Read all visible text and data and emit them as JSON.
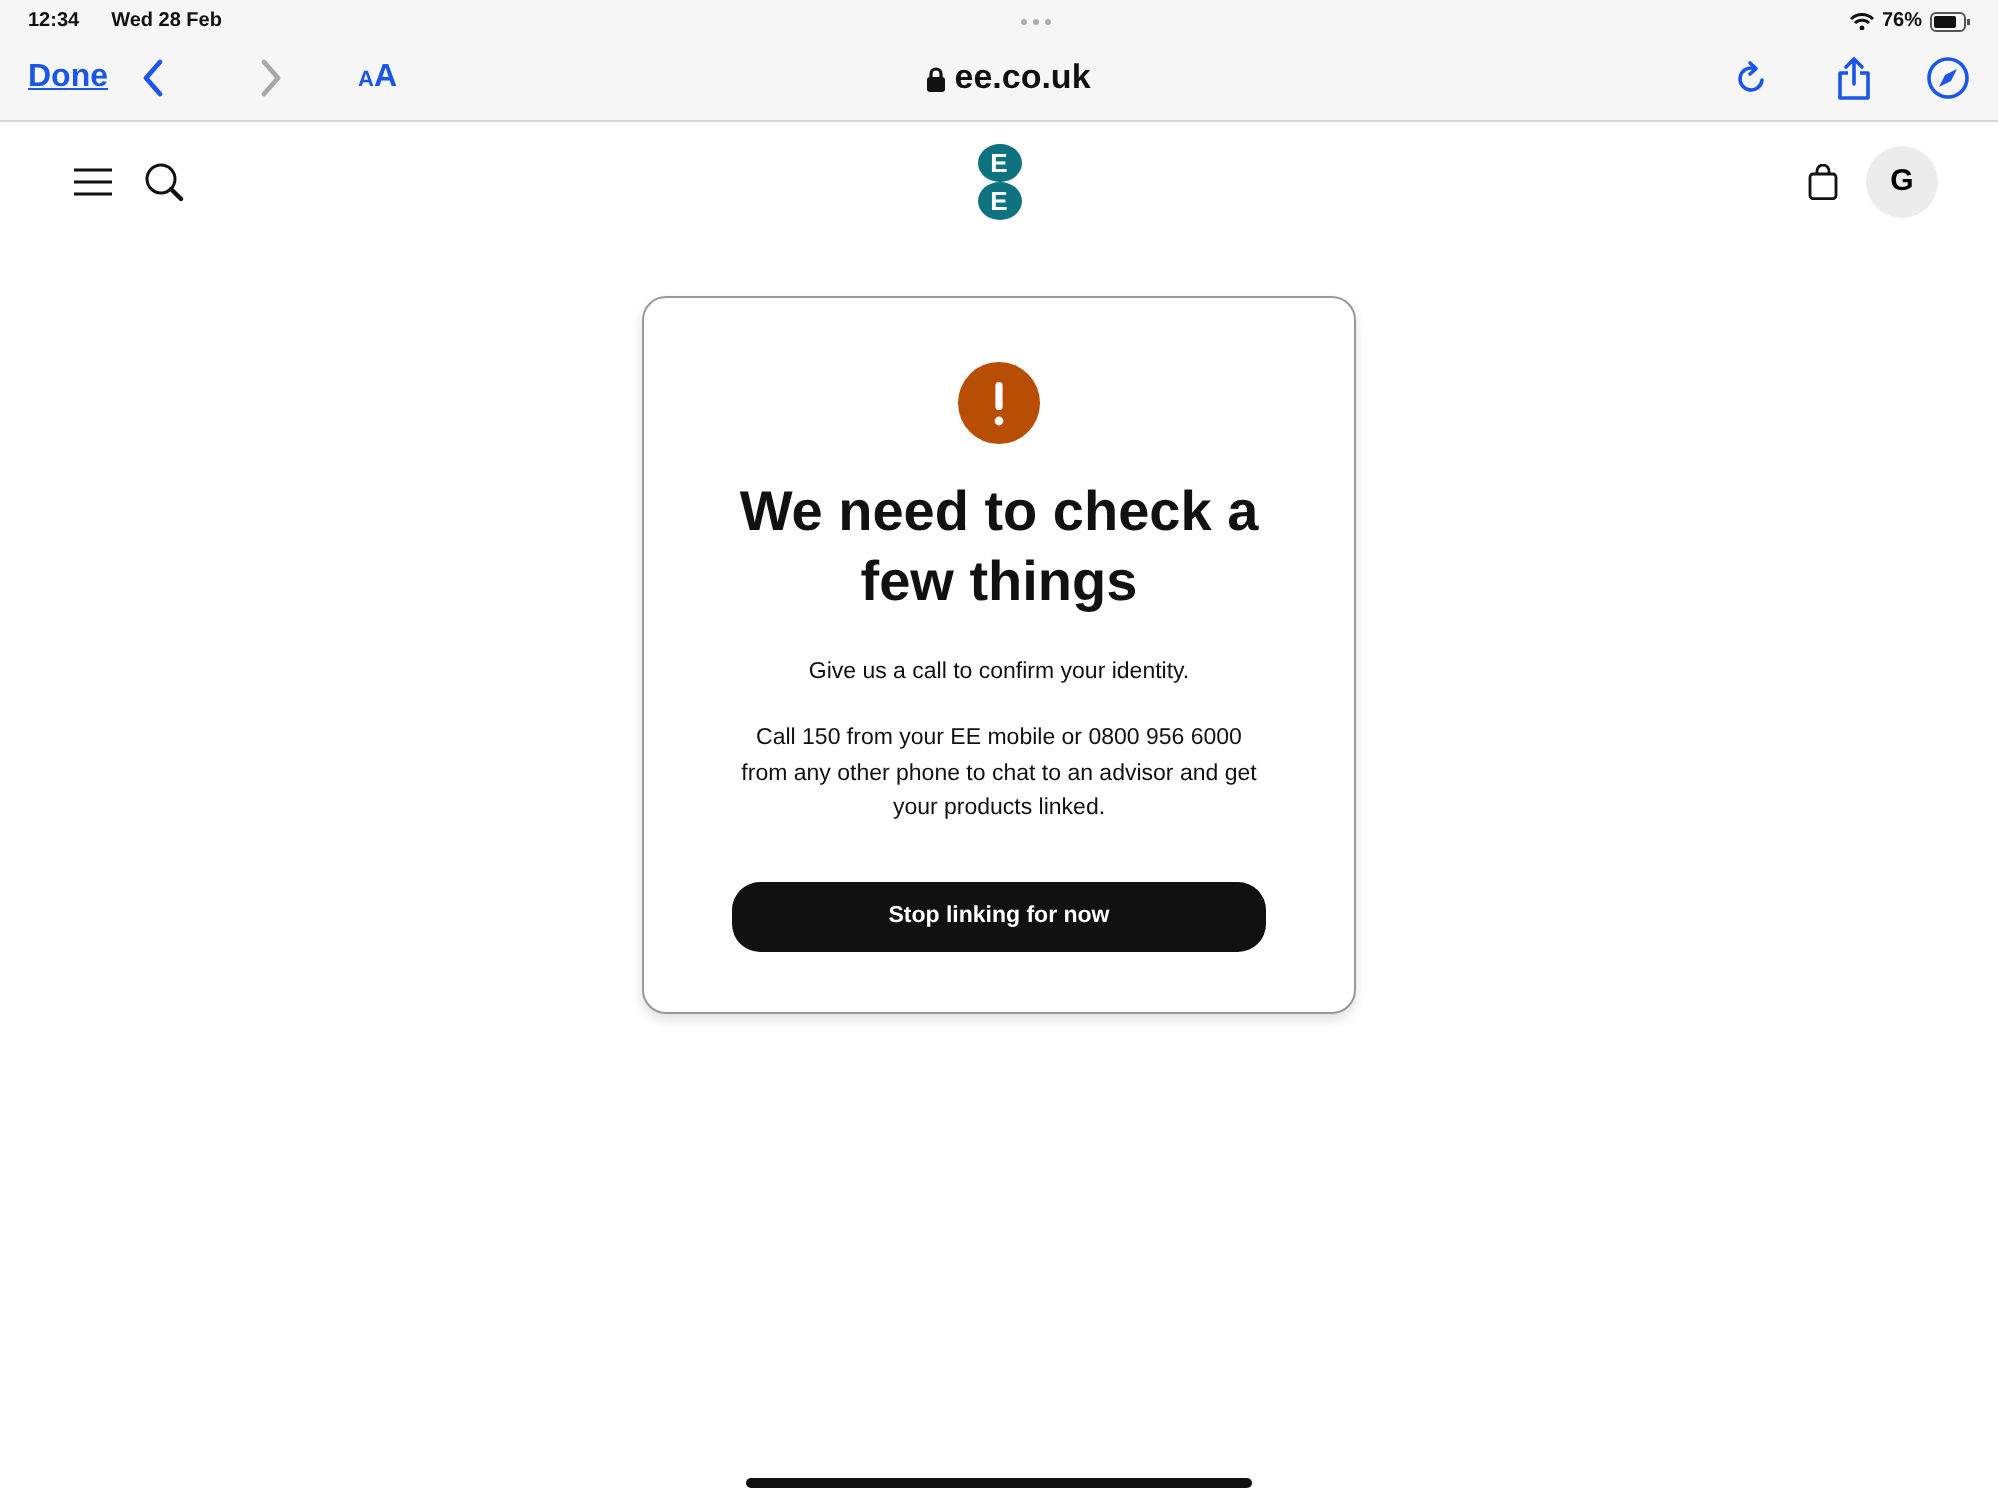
{
  "status_bar": {
    "time": "12:34",
    "date": "Wed 28 Feb",
    "battery": "76%"
  },
  "browser_toolbar": {
    "done": "Done",
    "back": {
      "disabled": false
    },
    "forward": {
      "disabled": true
    },
    "text_size": [
      "A",
      "A"
    ],
    "address": "ee.co.uk"
  },
  "site_header": {
    "logo": [
      "E",
      "E"
    ],
    "account_initial": "G"
  },
  "dialog": {
    "title": "We need to check a few things",
    "paragraphs": [
      "Give us a call to confirm your identity.",
      "Call 150 from your EE mobile or 0800 956 6000 from any other phone to chat to an advisor and get your products linked."
    ],
    "button": "Stop linking for now"
  }
}
